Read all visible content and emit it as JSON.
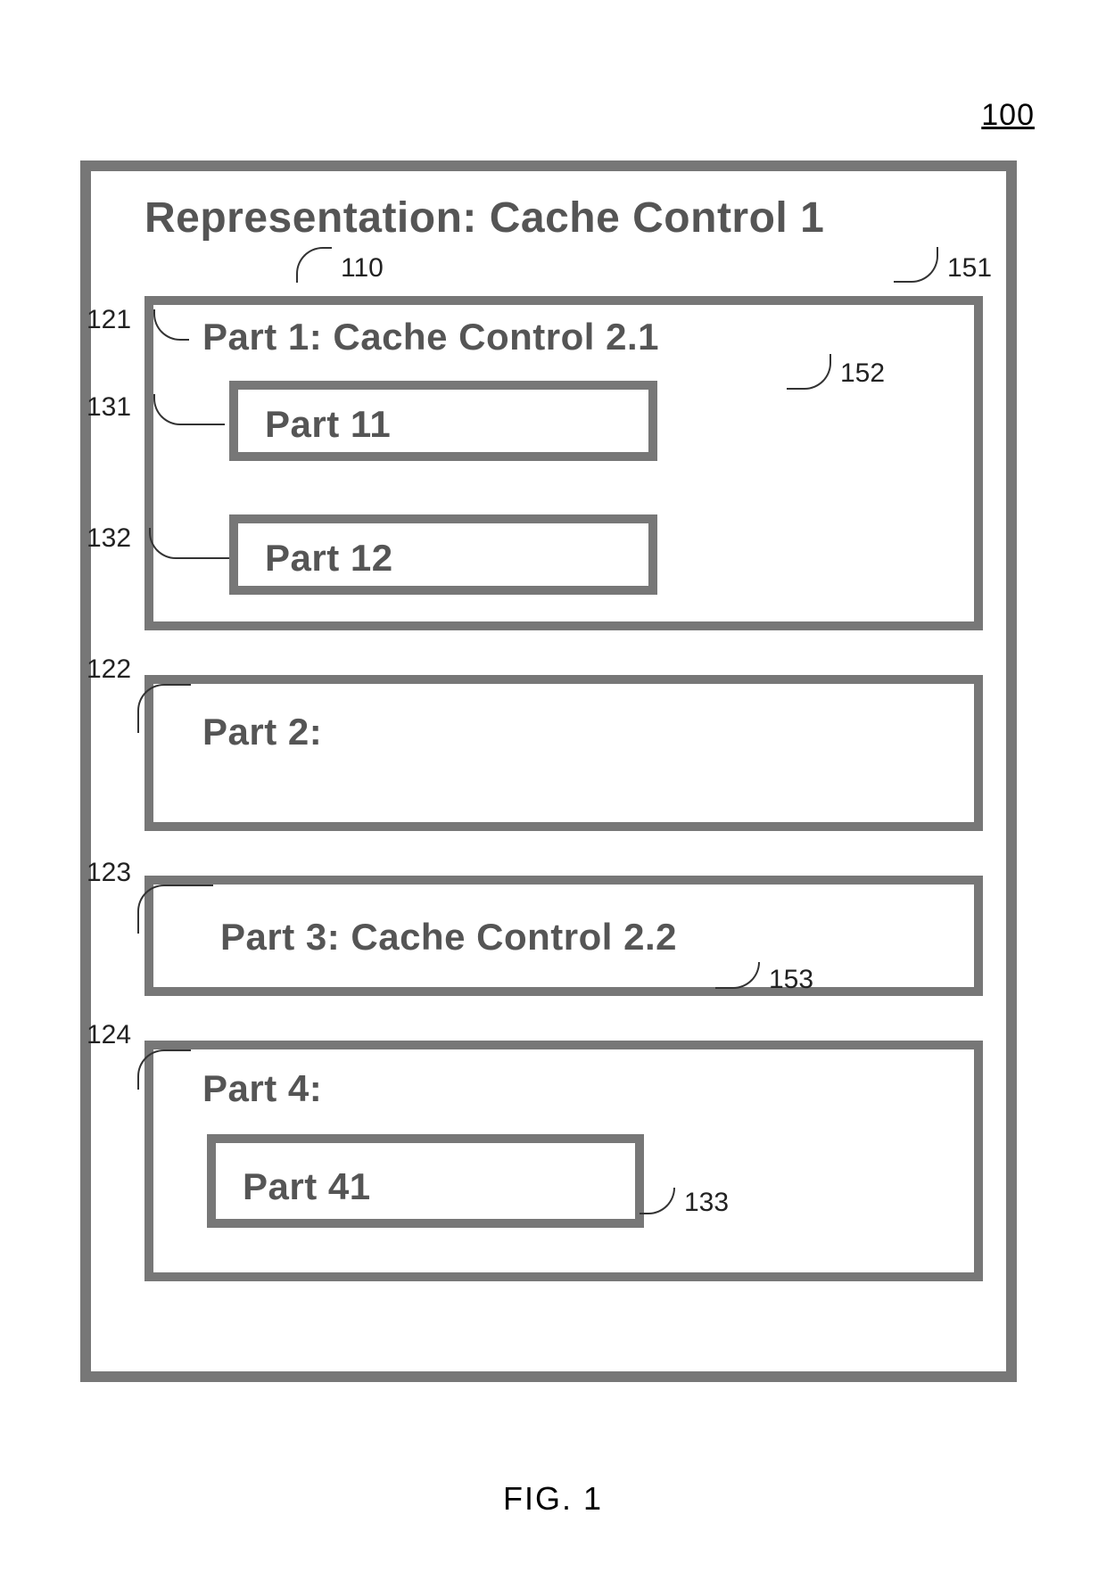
{
  "page_number": "100",
  "figure_caption": "FIG. 1",
  "outer": {
    "title": "Representation: Cache Control 1",
    "ref_title": "110",
    "ref_cache": "151"
  },
  "part1": {
    "title": "Part 1: Cache Control 2.1",
    "ref_box": "121",
    "ref_cache": "152",
    "sub11": {
      "title": "Part 11",
      "ref": "131"
    },
    "sub12": {
      "title": "Part 12",
      "ref": "132"
    }
  },
  "part2": {
    "title": "Part 2:",
    "ref_box": "122"
  },
  "part3": {
    "title": "Part 3: Cache Control 2.2",
    "ref_box": "123",
    "ref_cache": "153"
  },
  "part4": {
    "title": "Part 4:",
    "ref_box": "124",
    "sub41": {
      "title": "Part 41",
      "ref": "133"
    }
  }
}
